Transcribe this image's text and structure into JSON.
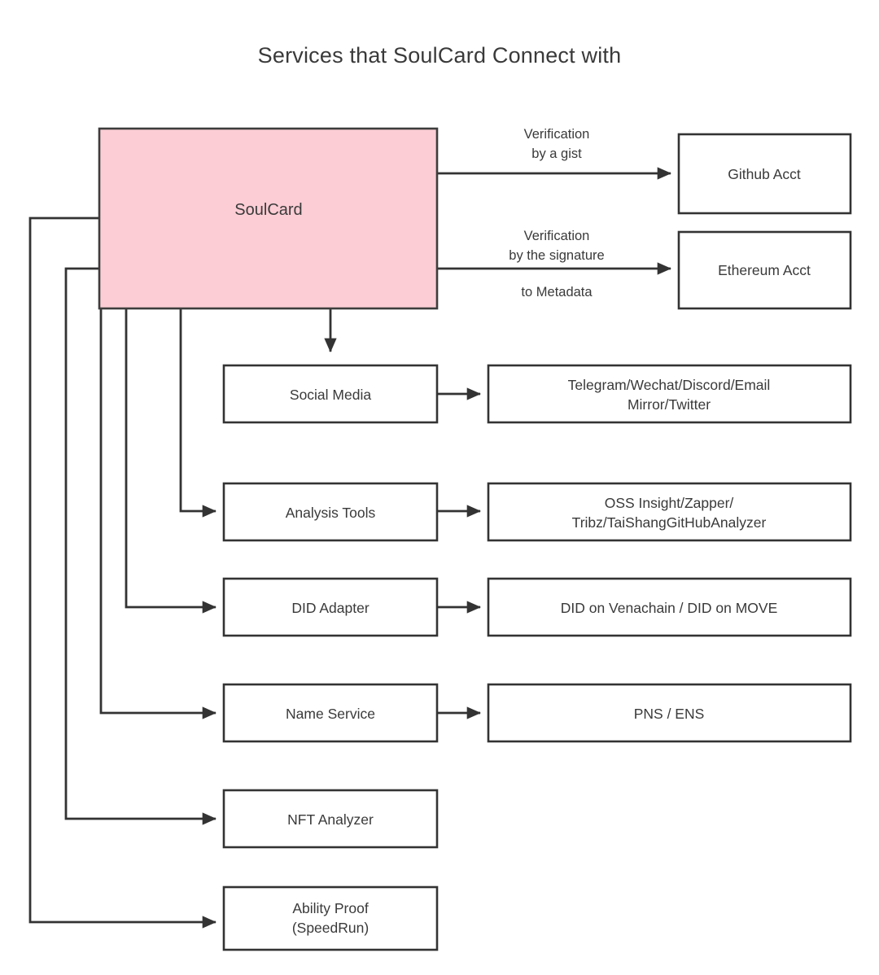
{
  "page": {
    "title": "Services that SoulCard Connect with",
    "background_color": "#ffffff",
    "text_color": "#3a3a3a",
    "line_color": "#333333",
    "accent_fill": "#fccdd5"
  },
  "nodes": {
    "soulcard": {
      "label": "SoulCard"
    },
    "github": {
      "label": "Github Acct"
    },
    "ethereum": {
      "label": "Ethereum Acct"
    },
    "social_media": {
      "label": "Social Media"
    },
    "social_media_targets": {
      "line1": "Telegram/Wechat/Discord/Email",
      "line2": "Mirror/Twitter"
    },
    "analysis_tools": {
      "label": "Analysis Tools"
    },
    "analysis_tools_targets": {
      "line1": "OSS Insight/Zapper/",
      "line2": "Tribz/TaiShangGitHubAnalyzer"
    },
    "did_adapter": {
      "label": "DID Adapter"
    },
    "did_adapter_targets": {
      "label": "DID on Venachain / DID on MOVE"
    },
    "name_service": {
      "label": "Name Service"
    },
    "name_service_targets": {
      "label": "PNS / ENS"
    },
    "nft_analyzer": {
      "label": "NFT Analyzer"
    },
    "ability_proof": {
      "line1": "Ability Proof",
      "line2": "(SpeedRun)"
    }
  },
  "edges": {
    "github_edge": {
      "line1": "Verification",
      "line2": "by a gist"
    },
    "ethereum_edge": {
      "line1": "Verification",
      "line2": "by the signature",
      "line3": "to Metadata"
    }
  }
}
